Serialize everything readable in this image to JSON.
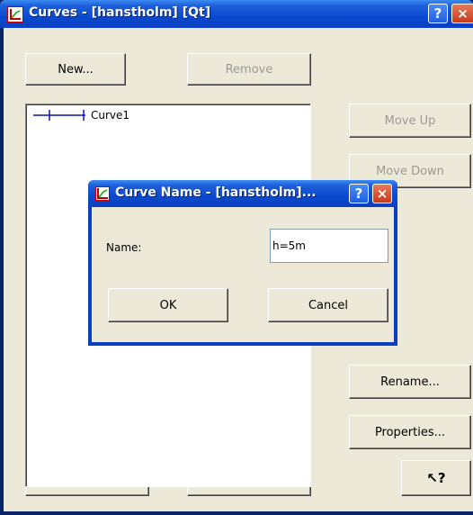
{
  "window": {
    "title": "Curves - [hanstholm] [Qt]",
    "help_glyph": "?",
    "close_glyph": "×"
  },
  "buttons": {
    "new": "New...",
    "remove": "Remove",
    "move_up": "Move Up",
    "move_down": "Move Down",
    "rename": "Rename...",
    "properties": "Properties...",
    "ok": "OK",
    "cancel": "Cancel",
    "context_help_glyph": "↖?"
  },
  "curve_list": {
    "items": [
      {
        "label": "Curve1"
      }
    ]
  },
  "dialog": {
    "title": "Curve Name - [hanstholm]...",
    "help_glyph": "?",
    "close_glyph": "×",
    "name_label": "Name:",
    "name_value": "h=5m",
    "ok": "OK",
    "cancel": "Cancel"
  },
  "colors": {
    "title_bar": "#0a4ad0",
    "client_bg": "#ece9d8",
    "close_button": "#c8391a",
    "curve_line": "#1010c0"
  }
}
